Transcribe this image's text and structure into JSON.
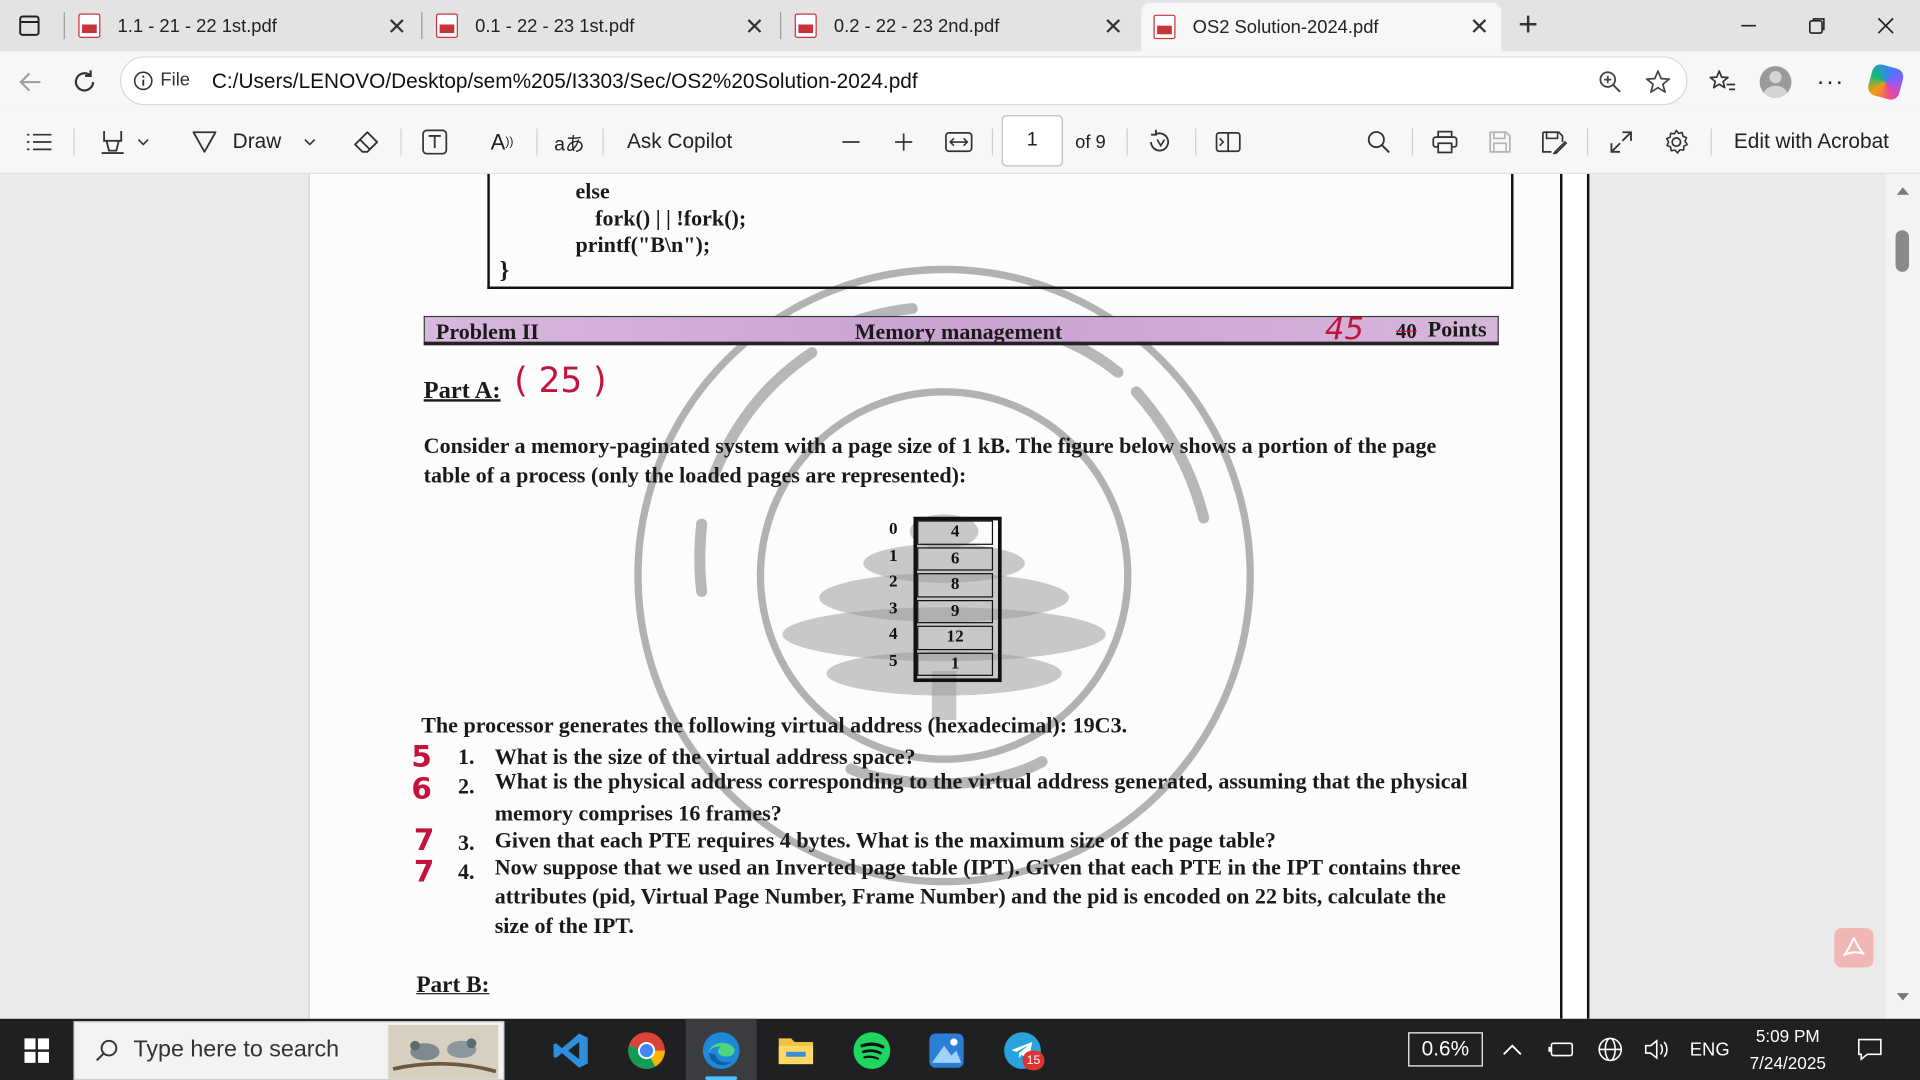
{
  "tabs": [
    {
      "title": "1.1 - 21 - 22 1st.pdf"
    },
    {
      "title": "0.1 - 22 - 23 1st.pdf"
    },
    {
      "title": "0.2 - 22 - 23 2nd.pdf"
    },
    {
      "title": "OS2 Solution-2024.pdf"
    }
  ],
  "address": {
    "scheme_label": "File",
    "url": "C:/Users/LENOVO/Desktop/sem%205/I3303/Sec/OS2%20Solution-2024.pdf"
  },
  "pdf_toolbar": {
    "draw_label": "Draw",
    "ask_copilot_label": "Ask Copilot",
    "page_current": "1",
    "page_total_label": "of 9",
    "edit_acrobat_label": "Edit with Acrobat"
  },
  "document": {
    "code_lines": [
      "else",
      "fork() | | !fork();",
      "printf(\"B\\n\");",
      "}"
    ],
    "problem_banner": {
      "left": "Problem II",
      "center": "Memory management",
      "struck_points": "40",
      "points_label": "Points"
    },
    "part_a_heading": "Part A:",
    "intro_lines": [
      "Consider a memory-paginated system with a page size of 1 kB. The figure below shows a portion of the page",
      "table of a process (only the loaded pages are represented):"
    ],
    "page_table": {
      "pages": [
        "0",
        "1",
        "2",
        "3",
        "4",
        "5"
      ],
      "frames": [
        "4",
        "6",
        "8",
        "9",
        "12",
        "1"
      ]
    },
    "processor_line": "The processor generates the following virtual address (hexadecimal): ",
    "virtual_address": "19C3.",
    "questions": [
      {
        "num": "1.",
        "lines": [
          "What is the size of the virtual address space?"
        ]
      },
      {
        "num": "2.",
        "lines": [
          "What is the physical address corresponding to the virtual address generated, assuming that the physical",
          "memory comprises 16 frames?"
        ]
      },
      {
        "num": "3.",
        "lines": [
          "Given that each PTE requires 4 bytes. What is the maximum size of the page table?"
        ]
      },
      {
        "num": "4.",
        "lines": [
          "Now suppose that we used an Inverted page table (IPT). Given that each PTE in the IPT contains three",
          "attributes (pid, Virtual Page Number, Frame Number) and the pid is encoded on 22 bits, calculate the",
          "size of the IPT."
        ]
      }
    ],
    "part_b_heading": "Part B:",
    "handwriting": {
      "points_total": "45",
      "part_a_score": "( 25 )",
      "question_scores": [
        "5",
        "6",
        "7",
        "7"
      ]
    }
  },
  "taskbar": {
    "search_placeholder": "Type here to search",
    "badge_count": "15",
    "cpu_label": "0.6%",
    "language": "ENG",
    "time": "5:09 PM",
    "date": "7/24/2025"
  },
  "colors": {
    "pdf_red": "#c7343c",
    "banner_purple": "#c9a2cf",
    "ink_red": "#c4123c",
    "taskbar_bg": "#1f2022"
  }
}
